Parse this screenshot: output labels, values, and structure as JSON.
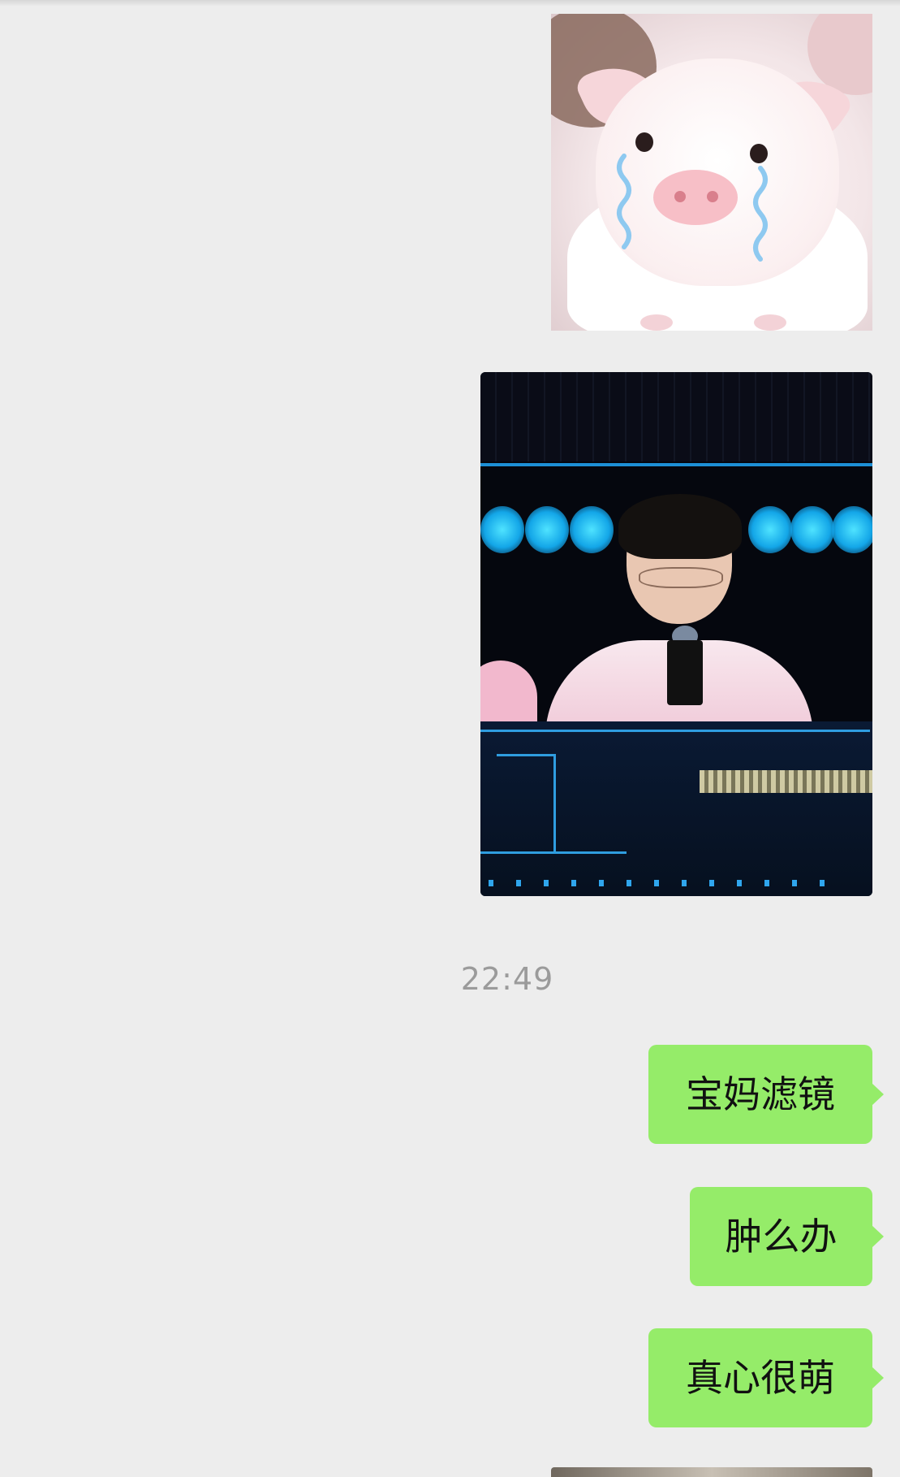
{
  "chat": {
    "timestamp": "22:49",
    "messages": [
      {
        "type": "image",
        "sender": "self",
        "description_icon": "crying-pig-sticker"
      },
      {
        "type": "image",
        "sender": "self",
        "description_icon": "stage-photo"
      },
      {
        "type": "text",
        "sender": "self",
        "text": "宝妈滤镜"
      },
      {
        "type": "text",
        "sender": "self",
        "text": "肿么办"
      },
      {
        "type": "text",
        "sender": "self",
        "text": "真心很萌"
      },
      {
        "type": "image",
        "sender": "self",
        "description_icon": "partial-image"
      }
    ]
  },
  "colors": {
    "background": "#ededed",
    "self_bubble": "#95ec69",
    "timestamp_text": "#9b9b9b"
  }
}
